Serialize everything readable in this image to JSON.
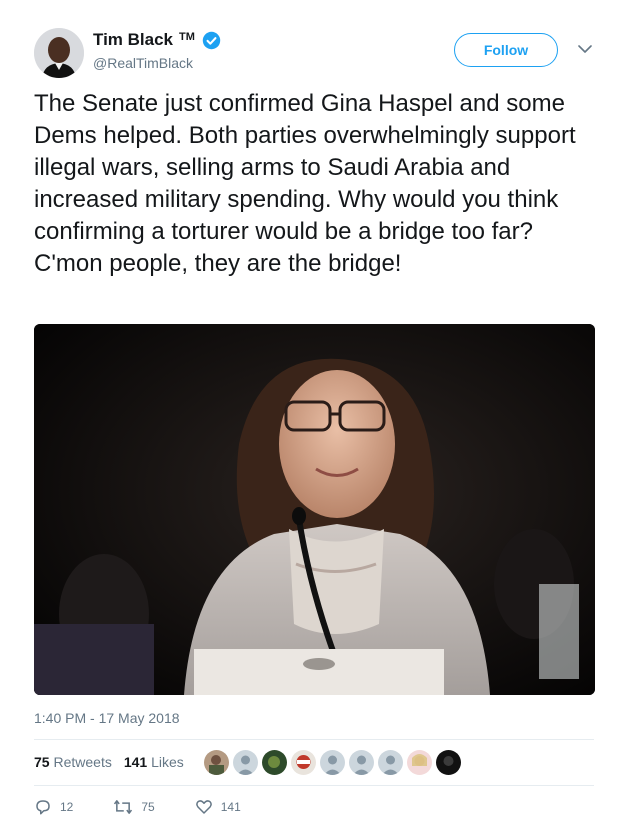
{
  "author": {
    "name": "Tim Black",
    "tm": "TM",
    "handle": "@RealTimBlack",
    "verified": true,
    "follow_label": "Follow"
  },
  "tweet": {
    "text": "The Senate just confirmed Gina Haspel and some Dems helped. Both parties overwhelmingly support illegal wars, selling arms to Saudi Arabia and increased military spending. Why would you think confirming a torturer would be a bridge too far? C'mon people, they are the bridge!",
    "timestamp": "1:40 PM - 17 May 2018"
  },
  "stats": {
    "retweets_count": "75",
    "retweets_label": "Retweets",
    "likes_count": "141",
    "likes_label": "Likes"
  },
  "actions": {
    "reply_count": "12",
    "retweet_count": "75",
    "like_count": "141"
  },
  "colors": {
    "accent": "#1da1f2",
    "secondary_text": "#657786",
    "primary_text": "#14171a"
  }
}
